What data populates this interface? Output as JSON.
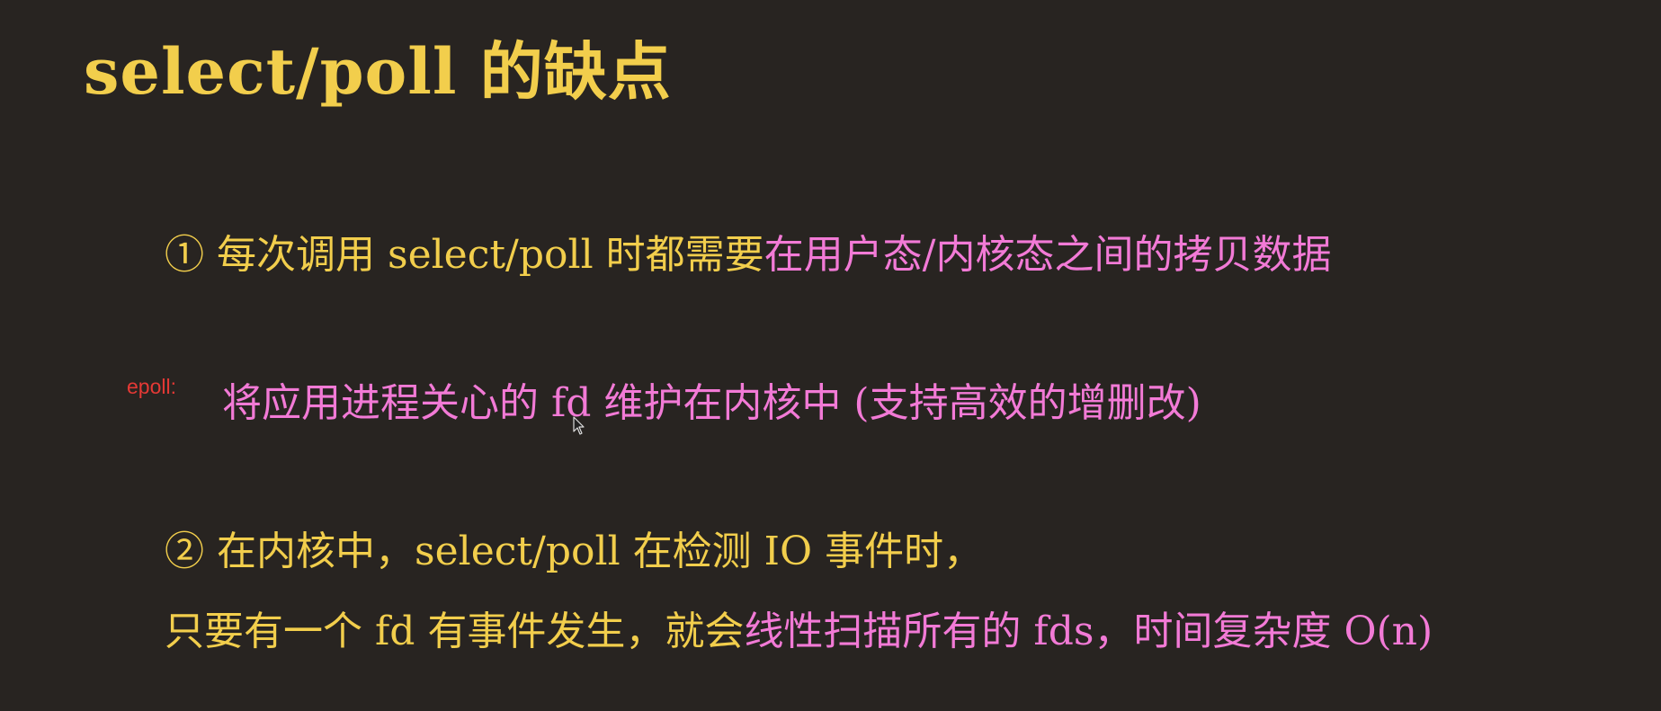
{
  "title": "select/poll 的缺点",
  "point1": {
    "marker": "①",
    "text_yellow": "每次调用 select/poll 时都需要",
    "text_pink": "在用户态/内核态之间的拷贝数据"
  },
  "epoll_note": {
    "label": "epoll:",
    "text": "将应用进程关心的 fd 维护在内核中 (支持高效的增删改)"
  },
  "point2": {
    "marker": "②",
    "line1": "在内核中，select/poll 在检测 IO 事件时，",
    "line2_yellow": "只要有一个 fd 有事件发生，就会",
    "line2_pink": "线性扫描所有的 fds，时间复杂度 O(n)"
  },
  "colors": {
    "background": "#282421",
    "primary_text": "#f2ce4c",
    "highlight_text": "#f27ad6",
    "annotation": "#e53935"
  },
  "icons": {
    "cursor": "mouse-pointer-icon"
  }
}
